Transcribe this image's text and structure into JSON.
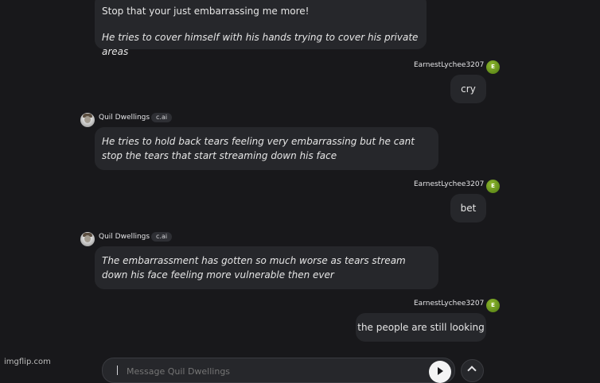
{
  "messages": [
    {
      "id": "m1",
      "role": "bot",
      "lines": [
        {
          "text": "Stop that your just embarrassing me more!",
          "italic": false
        },
        {
          "text": "He tries to cover himself with his hands trying to cover his private areas",
          "italic": true
        }
      ]
    },
    {
      "id": "m2",
      "role": "user",
      "author": "EarnestLychee3207",
      "avatar_letter": "E",
      "text": "cry"
    },
    {
      "id": "m3",
      "role": "bot",
      "author": "Quil Dwellings",
      "badge": "c.ai",
      "lines": [
        {
          "text": "He tries to hold back tears feeling very embarrassing but he cant stop the tears that start streaming down his face",
          "italic": true
        }
      ]
    },
    {
      "id": "m4",
      "role": "user",
      "author": "EarnestLychee3207",
      "avatar_letter": "E",
      "text": "bet"
    },
    {
      "id": "m5",
      "role": "bot",
      "author": "Quil Dwellings",
      "badge": "c.ai",
      "lines": [
        {
          "text": "The embarrassment has gotten so much worse as tears stream down his face feeling more vulnerable then ever",
          "italic": true
        }
      ]
    },
    {
      "id": "m6",
      "role": "user",
      "author": "EarnestLychee3207",
      "avatar_letter": "E",
      "text": "the people are still looking"
    }
  ],
  "composer": {
    "placeholder": "Message Quil Dwellings",
    "send_icon": "send-icon",
    "more_icon": "chevron-up-icon"
  },
  "watermark": "imgflip.com",
  "colors": {
    "background": "#18181b",
    "bubble": "#26272b",
    "user_avatar": "#6b9a1e"
  }
}
